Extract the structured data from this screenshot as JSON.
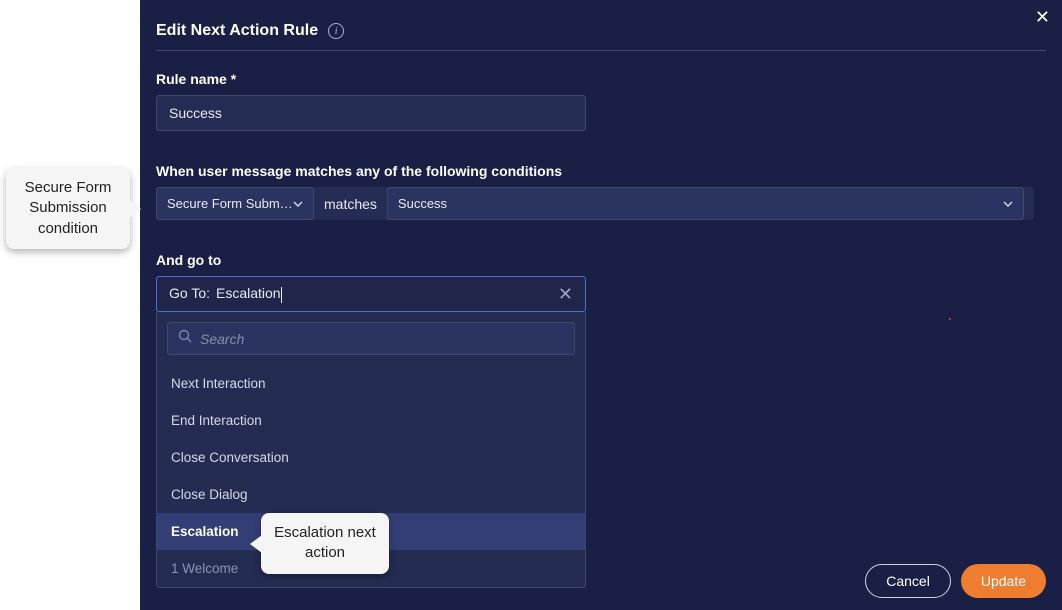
{
  "dialog": {
    "title": "Edit Next Action Rule",
    "close_glyph": "✕"
  },
  "rule_name": {
    "label": "Rule name *",
    "value": "Success"
  },
  "conditions": {
    "label": "When user message matches any of the following conditions",
    "type_value": "Secure Form Subm…",
    "operator": "matches",
    "match_value": "Success"
  },
  "goto": {
    "label": "And go to",
    "prefix": "Go To:",
    "value": "Escalation",
    "clear_glyph": "✕"
  },
  "dropdown": {
    "search_placeholder": "Search",
    "items": [
      {
        "label": "Next Interaction",
        "selected": false
      },
      {
        "label": "End Interaction",
        "selected": false
      },
      {
        "label": "Close Conversation",
        "selected": false
      },
      {
        "label": "Close Dialog",
        "selected": false
      },
      {
        "label": "Escalation",
        "selected": true
      },
      {
        "label": "1 Welcome",
        "selected": false,
        "sub": true
      }
    ]
  },
  "footer": {
    "cancel": "Cancel",
    "update": "Update"
  },
  "callouts": {
    "c1": "Secure Form Submission condition",
    "c2": "Escalation next action"
  }
}
